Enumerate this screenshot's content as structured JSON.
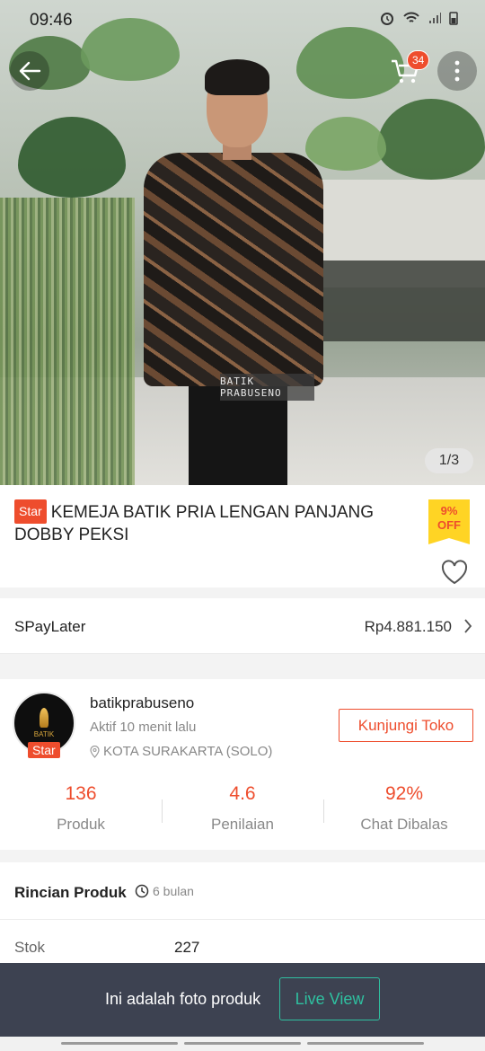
{
  "status_bar": {
    "time": "09:46"
  },
  "header": {
    "cart_count": "34",
    "image_counter": "1/3"
  },
  "product": {
    "star_badge": "Star",
    "title": "KEMEJA BATIK PRIA LENGAN PANJANG DOBBY PEKSI",
    "discount_line1": "9%",
    "discount_line2": "OFF"
  },
  "spaylater": {
    "label": "SPayLater",
    "amount": "Rp4.881.150"
  },
  "shop": {
    "name": "batikprabuseno",
    "active_status": "Aktif 10 menit lalu",
    "location": "KOTA SURAKARTA (SOLO)",
    "star_badge": "Star",
    "visit_button": "Kunjungi Toko",
    "stats": [
      {
        "value": "136",
        "label": "Produk"
      },
      {
        "value": "4.6",
        "label": "Penilaian"
      },
      {
        "value": "92%",
        "label": "Chat Dibalas"
      }
    ]
  },
  "details": {
    "heading": "Rincian Produk",
    "age": "6 bulan",
    "rows": [
      {
        "key": "Stok",
        "value": "227"
      }
    ]
  },
  "overlay": {
    "message": "Ini adalah foto produk",
    "live_view_button": "Live View"
  },
  "colors": {
    "accent": "#ee4d2d",
    "discount_tag": "#ffd424",
    "overlay_bg": "#3d4251",
    "live_view": "#2fc0a0"
  },
  "icons": [
    "back-arrow-icon",
    "cart-icon",
    "more-vertical-icon",
    "heart-icon",
    "chevron-right-icon",
    "location-pin-icon",
    "clock-icon"
  ]
}
